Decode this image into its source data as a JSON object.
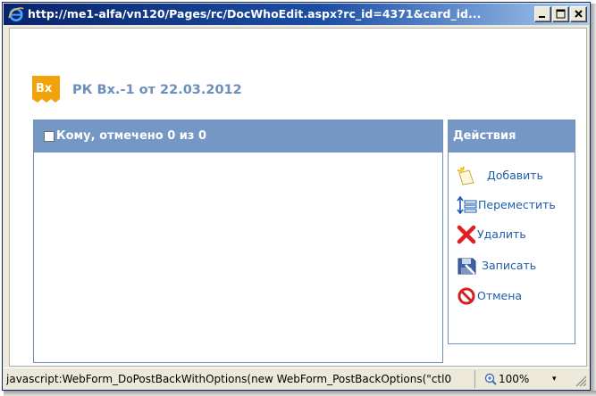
{
  "window": {
    "title": "http://me1-alfa/vn120/Pages/rc/DocWhoEdit.aspx?rc_id=4371&card_id..."
  },
  "document": {
    "badge": "Вх",
    "title": "РК Вх.-1 от 22.03.2012"
  },
  "recipients": {
    "header": "Кому, отмечено 0 из 0",
    "checked": false
  },
  "actions": {
    "title": "Действия",
    "items": [
      {
        "label": "Добавить",
        "icon": "add-icon"
      },
      {
        "label": "Переместить",
        "icon": "move-icon"
      },
      {
        "label": "Удалить",
        "icon": "delete-icon"
      },
      {
        "label": "Записать",
        "icon": "save-icon"
      },
      {
        "label": "Отмена",
        "icon": "cancel-icon"
      }
    ]
  },
  "statusbar": {
    "text": "javascript:WebForm_DoPostBackWithOptions(new WebForm_PostBackOptions(\"ctl0",
    "zoom": "100%",
    "zoom_arrow": "▾"
  },
  "colors": {
    "header_bg": "#7597c6",
    "link": "#1c5ea8",
    "title_text": "#6b8fbd",
    "badge": "#f2a20a"
  }
}
